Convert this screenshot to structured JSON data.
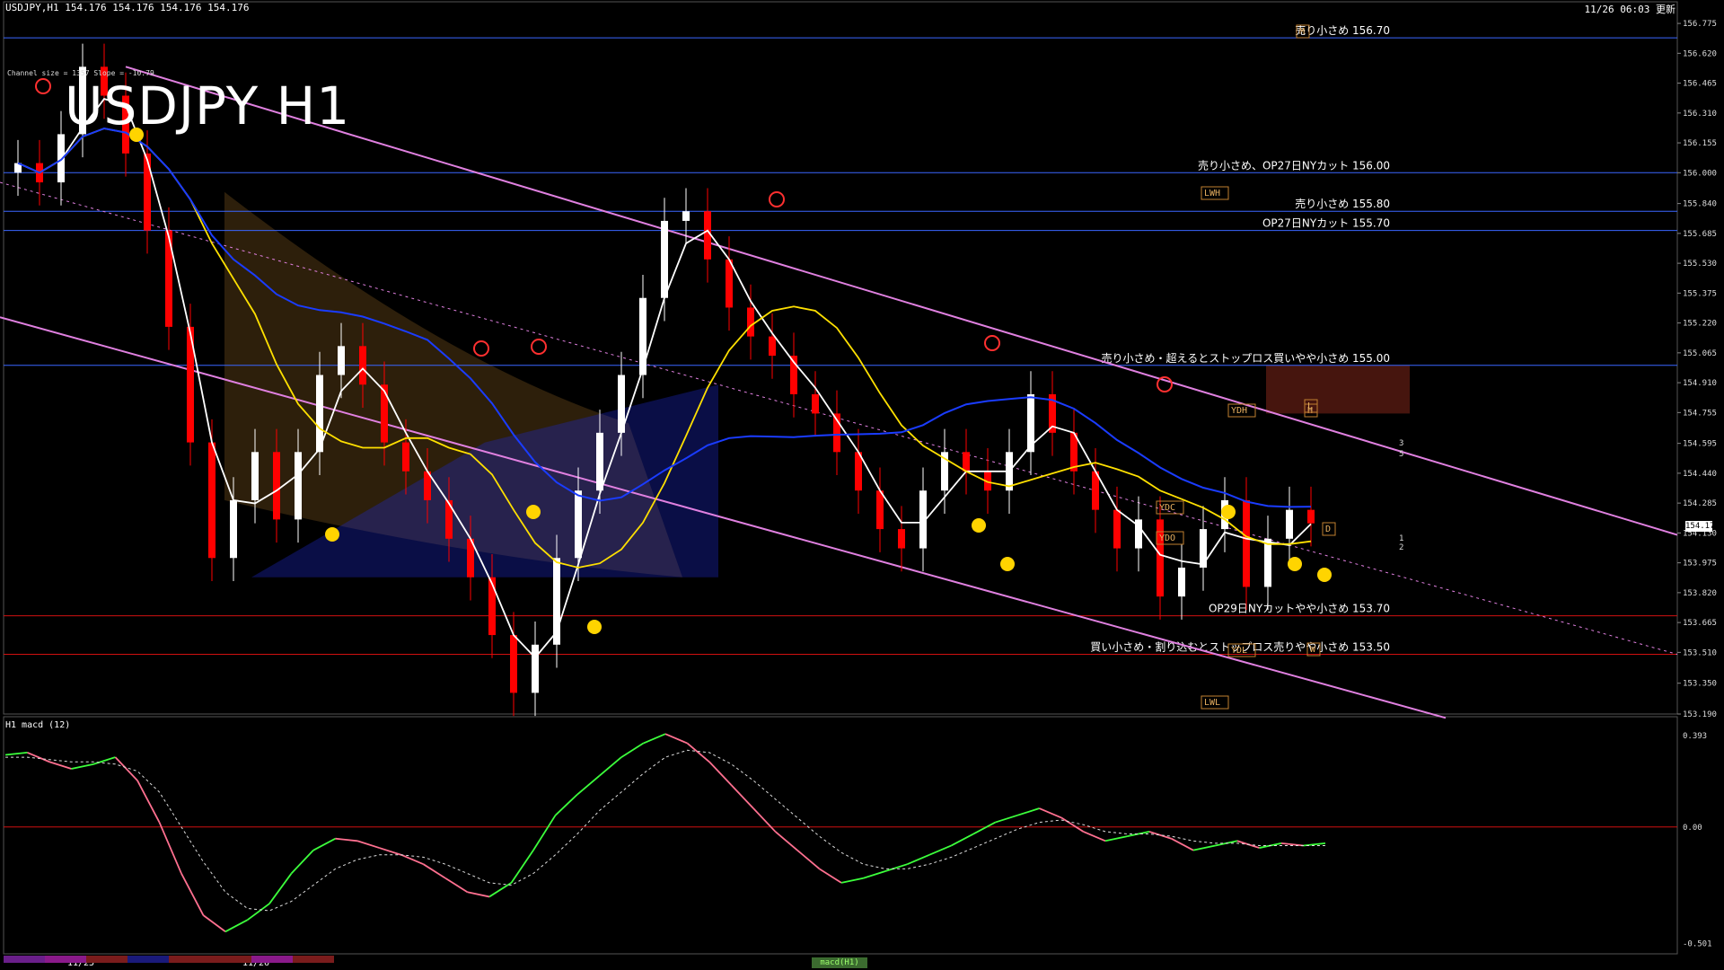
{
  "header": {
    "symbol_line": "USDJPY,H1  154.176 154.176 154.176 154.176",
    "datetime": "11/26 06:03 更新",
    "title": "USDJPY H1",
    "channel_info": "Channel size = 1357 Slope = -10.79",
    "macd_label": "H1  macd (12)",
    "bottom_tab": "macd(H1)",
    "current_price": "154.176"
  },
  "colors": {
    "bull_candle": "#ffffff",
    "bear_candle": "#ff0000",
    "level_line": "#1f4fd6",
    "support_line": "#d01010",
    "channel": "#e080e0",
    "ma_white": "#ffffff",
    "ma_yellow": "#ffe000",
    "ma_blue": "#1a3cff",
    "macd_up": "#3cff3c",
    "macd_down": "#ff7090"
  },
  "chart_data": [
    {
      "type": "candlestick",
      "title": "USDJPY H1",
      "y_ticks": [
        "156.775",
        "156.620",
        "156.465",
        "156.310",
        "156.155",
        "156.000",
        "155.840",
        "155.685",
        "155.530",
        "155.375",
        "155.220",
        "155.065",
        "154.910",
        "154.755",
        "154.595",
        "154.440",
        "154.285",
        "154.130",
        "153.975",
        "153.820",
        "153.665",
        "153.510",
        "153.350",
        "153.190"
      ],
      "ylim": [
        153.19,
        156.85
      ],
      "x_labels": [
        "11/25",
        "11/26"
      ],
      "price_levels": [
        {
          "price": 156.7,
          "label": "売り小さめ 156.70",
          "color": "#3a66ff"
        },
        {
          "price": 156.0,
          "label": "売り小さめ、OP27日NYカット 156.00",
          "color": "#3a66ff"
        },
        {
          "price": 155.8,
          "label": "売り小さめ 155.80",
          "color": "#3a66ff"
        },
        {
          "price": 155.7,
          "label": "OP27日NYカット 155.70",
          "color": "#3a66ff"
        },
        {
          "price": 155.0,
          "label": "売り小さめ・超えるとストップロス買いやや小さめ 155.00",
          "color": "#3a66ff"
        },
        {
          "price": 153.7,
          "label": "OP29日NYカットやや小さめ 153.70",
          "color": "#d01010"
        },
        {
          "price": 153.5,
          "label": "買い小さめ・割り込むとストップロス売りやや小さめ 153.50",
          "color": "#d01010"
        }
      ],
      "marker_labels": [
        "LWH",
        "YDH",
        "YDC",
        "YDO",
        "YDL",
        "LWL",
        "H",
        "L",
        "D",
        "W",
        "M"
      ],
      "channel_labels": [
        "3",
        "5",
        "1",
        "2"
      ],
      "series": [
        {
          "name": "close",
          "values": [
            156.05,
            155.95,
            156.2,
            156.55,
            156.4,
            156.1,
            155.7,
            155.2,
            154.6,
            154.0,
            154.3,
            154.55,
            154.2,
            154.55,
            154.95,
            155.1,
            154.9,
            154.6,
            154.45,
            154.3,
            154.1,
            153.9,
            153.6,
            153.3,
            153.55,
            154.0,
            154.35,
            154.65,
            154.95,
            155.35,
            155.75,
            155.8,
            155.55,
            155.3,
            155.15,
            155.05,
            154.85,
            154.75,
            154.55,
            154.35,
            154.15,
            154.05,
            154.35,
            154.55,
            154.45,
            154.35,
            154.55,
            154.85,
            154.65,
            154.45,
            154.25,
            154.05,
            154.2,
            153.8,
            153.95,
            154.15,
            154.3,
            153.85,
            154.1,
            154.25,
            154.18
          ]
        }
      ]
    },
    {
      "type": "line",
      "title": "H1 macd (12)",
      "y_ticks": [
        "0.393",
        "0.00",
        "-0.501"
      ],
      "ylim": [
        -0.53,
        0.42
      ],
      "series": [
        {
          "name": "macd",
          "values": [
            0.31,
            0.32,
            0.28,
            0.25,
            0.27,
            0.3,
            0.2,
            0.02,
            -0.2,
            -0.38,
            -0.45,
            -0.4,
            -0.33,
            -0.2,
            -0.1,
            -0.05,
            -0.06,
            -0.09,
            -0.12,
            -0.16,
            -0.22,
            -0.28,
            -0.3,
            -0.24,
            -0.1,
            0.05,
            0.14,
            0.22,
            0.3,
            0.36,
            0.4,
            0.36,
            0.28,
            0.18,
            0.08,
            -0.02,
            -0.1,
            -0.18,
            -0.24,
            -0.22,
            -0.19,
            -0.16,
            -0.12,
            -0.08,
            -0.03,
            0.02,
            0.05,
            0.08,
            0.04,
            -0.02,
            -0.06,
            -0.04,
            -0.02,
            -0.05,
            -0.1,
            -0.08,
            -0.06,
            -0.09,
            -0.07,
            -0.08,
            -0.07
          ]
        },
        {
          "name": "signal",
          "values": [
            0.3,
            0.3,
            0.29,
            0.28,
            0.28,
            0.27,
            0.24,
            0.15,
            0.0,
            -0.15,
            -0.28,
            -0.35,
            -0.36,
            -0.32,
            -0.25,
            -0.18,
            -0.14,
            -0.12,
            -0.12,
            -0.13,
            -0.16,
            -0.2,
            -0.24,
            -0.25,
            -0.2,
            -0.12,
            -0.03,
            0.07,
            0.15,
            0.23,
            0.3,
            0.33,
            0.32,
            0.27,
            0.2,
            0.12,
            0.04,
            -0.04,
            -0.11,
            -0.16,
            -0.18,
            -0.18,
            -0.16,
            -0.13,
            -0.09,
            -0.05,
            -0.01,
            0.02,
            0.03,
            0.01,
            -0.02,
            -0.03,
            -0.03,
            -0.04,
            -0.06,
            -0.07,
            -0.07,
            -0.08,
            -0.08,
            -0.08,
            -0.08
          ]
        }
      ]
    }
  ]
}
